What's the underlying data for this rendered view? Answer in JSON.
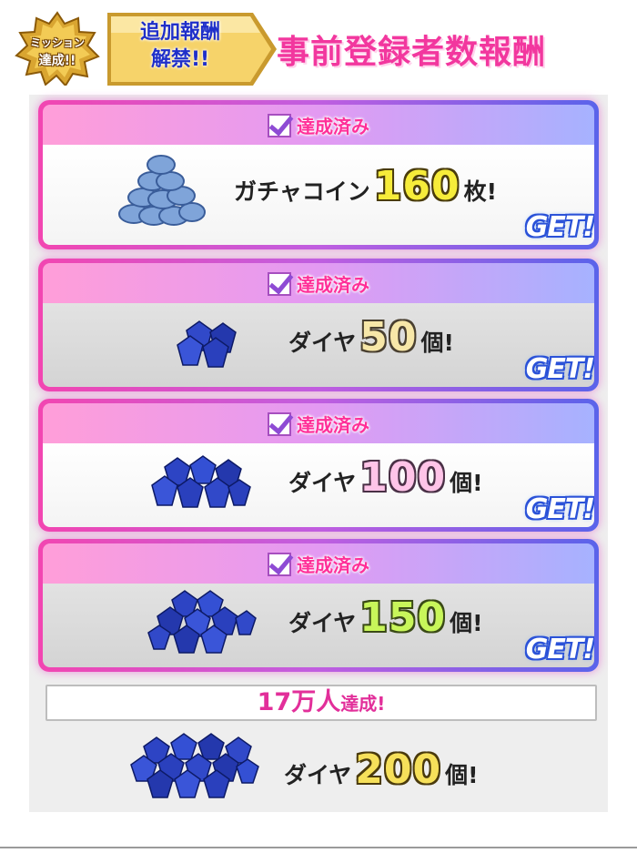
{
  "header": {
    "mission_badge": {
      "line1": "ミッション",
      "line2": "達成!!"
    },
    "unlock_banner": {
      "line1": "追加報酬",
      "line2": "解禁!!"
    },
    "title": "事前登録者数報酬"
  },
  "rewards": [
    {
      "status": "達成済み",
      "item": "ガチャコイン",
      "amount": "160",
      "unit": "枚!",
      "get": "GET!",
      "icon": "coin-stack-icon",
      "color": "#f6ec3a"
    },
    {
      "status": "達成済み",
      "item": "ダイヤ",
      "amount": "50",
      "unit": "個!",
      "get": "GET!",
      "icon": "diamond-small-icon",
      "color": "#f7e7a8"
    },
    {
      "status": "達成済み",
      "item": "ダイヤ",
      "amount": "100",
      "unit": "個!",
      "get": "GET!",
      "icon": "diamond-medium-icon",
      "color": "#ffc4e8"
    },
    {
      "status": "達成済み",
      "item": "ダイヤ",
      "amount": "150",
      "unit": "個!",
      "get": "GET!",
      "icon": "diamond-large-icon",
      "color": "#c8f65a"
    }
  ],
  "milestone": {
    "count": "17万人",
    "suffix": "達成!",
    "item": "ダイヤ",
    "amount": "200",
    "unit": "個!",
    "icon": "diamond-pile-icon",
    "color": "#f6e05a"
  },
  "colors": {
    "title_pink": "#f2379e",
    "frame_left": "#f246b1",
    "frame_right": "#5a63ea",
    "status_pink": "#ff2f98",
    "get_blue": "#2b52d8"
  }
}
